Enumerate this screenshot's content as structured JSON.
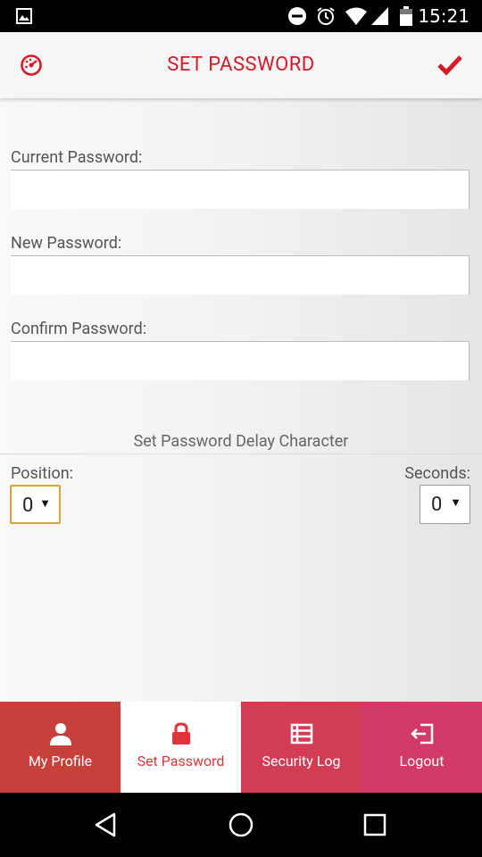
{
  "status_bar": {
    "time": "15:21"
  },
  "header": {
    "title": "SET PASSWORD"
  },
  "form": {
    "current_label": "Current Password:",
    "current_value": "",
    "new_label": "New Password:",
    "new_value": "",
    "confirm_label": "Confirm Password:",
    "confirm_value": ""
  },
  "delay": {
    "title": "Set Password Delay Character",
    "position_label": "Position:",
    "position_value": "0",
    "seconds_label": "Seconds:",
    "seconds_value": "0"
  },
  "tabs": [
    {
      "label": "My Profile",
      "icon": "user-icon"
    },
    {
      "label": "Set Password",
      "icon": "lock-icon"
    },
    {
      "label": "Security Log",
      "icon": "list-icon"
    },
    {
      "label": "Logout",
      "icon": "logout-icon"
    }
  ],
  "colors": {
    "accent": "#d51a2a",
    "tab_profile": "#c7403a",
    "tab_security": "#d23c54",
    "tab_logout": "#d23a68",
    "select_focus": "#d8a33c"
  }
}
